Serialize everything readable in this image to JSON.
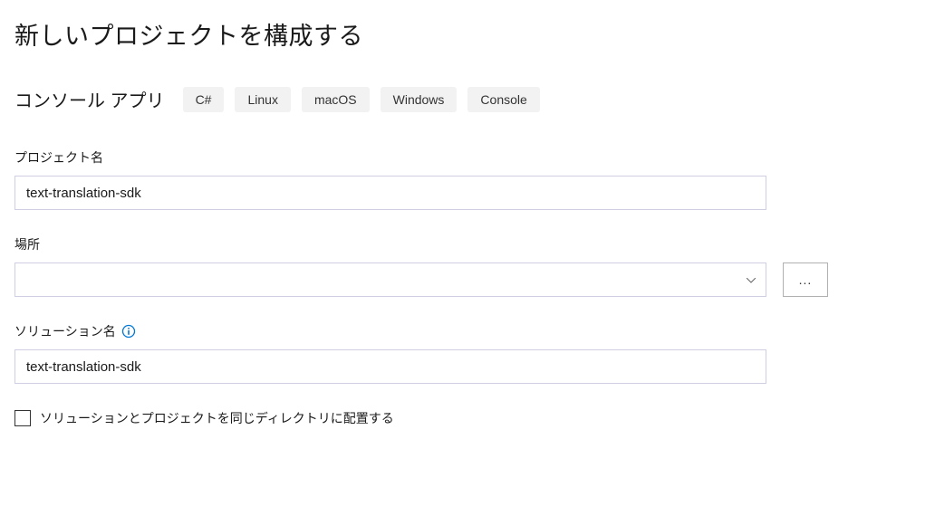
{
  "page": {
    "title": "新しいプロジェクトを構成する"
  },
  "appType": {
    "label": "コンソール アプリ",
    "tags": [
      "C#",
      "Linux",
      "macOS",
      "Windows",
      "Console"
    ]
  },
  "fields": {
    "projectName": {
      "label": "プロジェクト名",
      "value": "text-translation-sdk"
    },
    "location": {
      "label": "場所",
      "value": "",
      "browseLabel": "..."
    },
    "solutionName": {
      "label": "ソリューション名",
      "value": "text-translation-sdk"
    }
  },
  "checkbox": {
    "label": "ソリューションとプロジェクトを同じディレクトリに配置する",
    "checked": false
  }
}
